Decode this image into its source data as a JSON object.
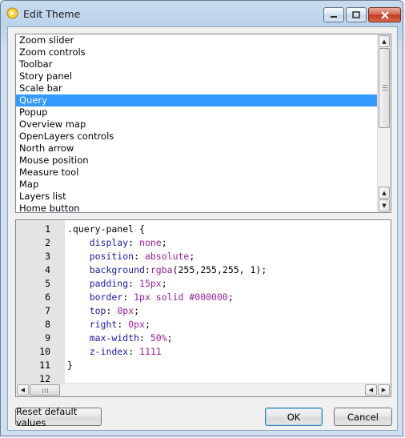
{
  "window": {
    "title": "Edit Theme"
  },
  "theme_list": {
    "items": [
      "Zoom slider",
      "Zoom controls",
      "Toolbar",
      "Story panel",
      "Scale bar",
      "Query",
      "Popup",
      "Overview map",
      "OpenLayers controls",
      "North arrow",
      "Mouse position",
      "Measure tool",
      "Map",
      "Layers list",
      "Home button"
    ],
    "selected": "Query"
  },
  "editor": {
    "line_numbers": [
      "1",
      "2",
      "3",
      "4",
      "5",
      "6",
      "7",
      "8",
      "9",
      "10",
      "11",
      "12"
    ],
    "lines": [
      [
        {
          "t": ".query-panel {",
          "c": "p"
        }
      ],
      [
        {
          "t": "    display",
          "c": "k"
        },
        {
          "t": ": ",
          "c": "p"
        },
        {
          "t": "none",
          "c": "v"
        },
        {
          "t": ";",
          "c": "p"
        }
      ],
      [
        {
          "t": "    position",
          "c": "k"
        },
        {
          "t": ": ",
          "c": "p"
        },
        {
          "t": "absolute",
          "c": "v"
        },
        {
          "t": ";",
          "c": "p"
        }
      ],
      [
        {
          "t": "    background",
          "c": "k"
        },
        {
          "t": ":",
          "c": "p"
        },
        {
          "t": "rgba",
          "c": "v"
        },
        {
          "t": "(255,255,255, 1);",
          "c": "p"
        }
      ],
      [
        {
          "t": "    padding",
          "c": "k"
        },
        {
          "t": ": ",
          "c": "p"
        },
        {
          "t": "15px",
          "c": "v"
        },
        {
          "t": ";",
          "c": "p"
        }
      ],
      [
        {
          "t": "    border",
          "c": "k"
        },
        {
          "t": ": ",
          "c": "p"
        },
        {
          "t": "1px solid #000000",
          "c": "v"
        },
        {
          "t": ";",
          "c": "p"
        }
      ],
      [
        {
          "t": "    top",
          "c": "k"
        },
        {
          "t": ": ",
          "c": "p"
        },
        {
          "t": "0px",
          "c": "v"
        },
        {
          "t": ";",
          "c": "p"
        }
      ],
      [
        {
          "t": "    right",
          "c": "k"
        },
        {
          "t": ": ",
          "c": "p"
        },
        {
          "t": "0px",
          "c": "v"
        },
        {
          "t": ";",
          "c": "p"
        }
      ],
      [
        {
          "t": "    max-width",
          "c": "k"
        },
        {
          "t": ": ",
          "c": "p"
        },
        {
          "t": "50%",
          "c": "v"
        },
        {
          "t": ";",
          "c": "p"
        }
      ],
      [
        {
          "t": "    z-index",
          "c": "k"
        },
        {
          "t": ": ",
          "c": "p"
        },
        {
          "t": "1111",
          "c": "v"
        }
      ],
      [
        {
          "t": "}",
          "c": "p"
        }
      ],
      []
    ]
  },
  "buttons": {
    "reset": "Reset default values",
    "ok": "OK",
    "cancel": "Cancel"
  },
  "colors": {
    "selection": "#3399ff",
    "property": "#1a1aa6",
    "value": "#9c1d9c"
  },
  "icons": {
    "app": "theme-icon",
    "minimize": "minimize-icon",
    "maximize": "maximize-icon",
    "close": "close-icon"
  }
}
